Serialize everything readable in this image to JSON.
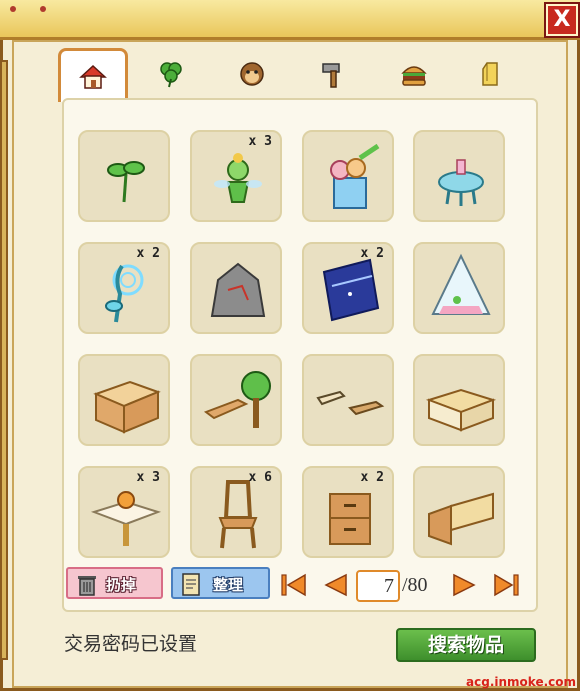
{
  "window": {
    "close_label": "X"
  },
  "tabs": [
    {
      "icon": "house-icon",
      "active": true
    },
    {
      "icon": "clover-icon",
      "active": false
    },
    {
      "icon": "monkey-face-icon",
      "active": false
    },
    {
      "icon": "hammer-icon",
      "active": false
    },
    {
      "icon": "burger-icon",
      "active": false
    },
    {
      "icon": "gold-bar-icon",
      "active": false
    }
  ],
  "items": [
    {
      "icon": "sprout-icon",
      "qty": ""
    },
    {
      "icon": "flower-fairy-icon",
      "qty": "x 3"
    },
    {
      "icon": "flower-glass-icon",
      "qty": ""
    },
    {
      "icon": "round-table-icon",
      "qty": ""
    },
    {
      "icon": "glowing-plant-icon",
      "qty": "x 2"
    },
    {
      "icon": "rock-icon",
      "qty": ""
    },
    {
      "icon": "starry-sheet-icon",
      "qty": "x 2"
    },
    {
      "icon": "terrarium-icon",
      "qty": ""
    },
    {
      "icon": "counter-icon",
      "qty": ""
    },
    {
      "icon": "bench-tree-icon",
      "qty": ""
    },
    {
      "icon": "low-table-icon",
      "qty": ""
    },
    {
      "icon": "sofa-icon",
      "qty": ""
    },
    {
      "icon": "flower-table-icon",
      "qty": "x 3"
    },
    {
      "icon": "wooden-chair-icon",
      "qty": "x 6"
    },
    {
      "icon": "cabinet-icon",
      "qty": "x 2"
    },
    {
      "icon": "corner-counter-icon",
      "qty": ""
    }
  ],
  "toolbar": {
    "discard_label": "扔掉",
    "sort_label": "整理"
  },
  "pagination": {
    "current": "7",
    "total": "/80"
  },
  "footer": {
    "status": "交易密码已设置",
    "search_label": "搜索物品",
    "watermark": "acg.inmoke.com"
  },
  "colors": {
    "frame": "#8a5a1e",
    "close": "#c82a1f",
    "search": "#3e8f2c",
    "page_accent": "#e08a2a"
  }
}
